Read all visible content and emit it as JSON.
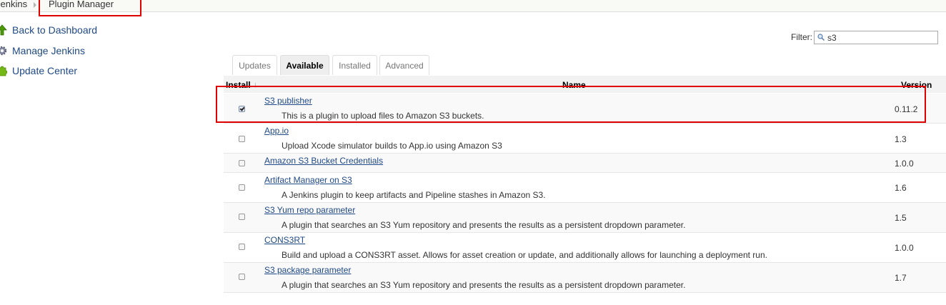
{
  "breadcrumb": {
    "root": "Jenkins",
    "current": "Plugin Manager"
  },
  "sidebar": {
    "items": [
      {
        "label": "Back to Dashboard",
        "icon": "up-arrow-icon"
      },
      {
        "label": "Manage Jenkins",
        "icon": "gear-icon"
      },
      {
        "label": "Update Center",
        "icon": "puzzle-icon"
      }
    ]
  },
  "filter": {
    "label": "Filter:",
    "value": "s3"
  },
  "tabs": [
    {
      "label": "Updates",
      "active": false
    },
    {
      "label": "Available",
      "active": true
    },
    {
      "label": "Installed",
      "active": false
    },
    {
      "label": "Advanced",
      "active": false
    }
  ],
  "table": {
    "headers": {
      "install": "Install",
      "sort_indicator": "↓",
      "name": "Name",
      "version": "Version"
    },
    "rows": [
      {
        "checked": true,
        "name": "S3 publisher",
        "description": "This is a plugin to upload files to Amazon S3 buckets.",
        "version": "0.11.2"
      },
      {
        "checked": false,
        "name": "App.io",
        "description": "Upload Xcode simulator builds to App.io using Amazon S3",
        "version": "1.3"
      },
      {
        "checked": false,
        "name": "Amazon S3 Bucket Credentials",
        "description": "",
        "version": "1.0.0"
      },
      {
        "checked": false,
        "name": "Artifact Manager on S3",
        "description": "A Jenkins plugin to keep artifacts and Pipeline stashes in Amazon S3.",
        "version": "1.6"
      },
      {
        "checked": false,
        "name": "S3 Yum repo parameter",
        "description": "A plugin that searches an S3 Yum repository and presents the results as a persistent dropdown parameter.",
        "version": "1.5"
      },
      {
        "checked": false,
        "name": "CONS3RT",
        "description": "Build and upload a CONS3RT asset. Allows for asset creation or update, and additionally allows for launching a deployment run.",
        "version": "1.0.0"
      },
      {
        "checked": false,
        "name": "S3 package parameter",
        "description": "A plugin that searches an S3 Yum repository and presents the results as a persistent dropdown parameter.",
        "version": "1.7"
      }
    ]
  },
  "colors": {
    "link": "#204a87",
    "highlight": "#e00000"
  }
}
